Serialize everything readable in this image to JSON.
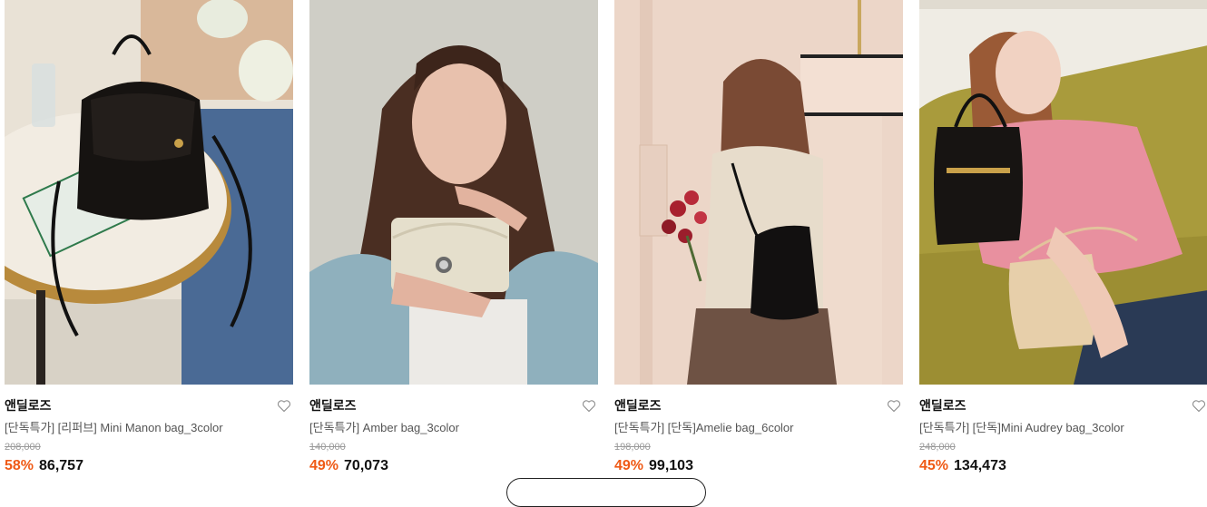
{
  "colors": {
    "discount": "#ef5a16",
    "original_price": "#9a9a9a",
    "title": "#555555"
  },
  "products": [
    {
      "brand": "앤딜로즈",
      "title": "[단독특가] [리퍼브] Mini Manon bag_3color",
      "original_price": "208,000",
      "discount_rate": "58%",
      "sale_price": "86,757",
      "wishlist_icon": "heart-outline-icon"
    },
    {
      "brand": "앤딜로즈",
      "title": "[단독특가] Amber bag_3color",
      "original_price": "140,000",
      "discount_rate": "49%",
      "sale_price": "70,073",
      "wishlist_icon": "heart-outline-icon"
    },
    {
      "brand": "앤딜로즈",
      "title": "[단독특가] [단독]Amelie bag_6color",
      "original_price": "198,000",
      "discount_rate": "49%",
      "sale_price": "99,103",
      "wishlist_icon": "heart-outline-icon"
    },
    {
      "brand": "앤딜로즈",
      "title": "[단독특가] [단독]Mini Audrey bag_3color",
      "original_price": "248,000",
      "discount_rate": "45%",
      "sale_price": "134,473",
      "wishlist_icon": "heart-outline-icon"
    }
  ]
}
